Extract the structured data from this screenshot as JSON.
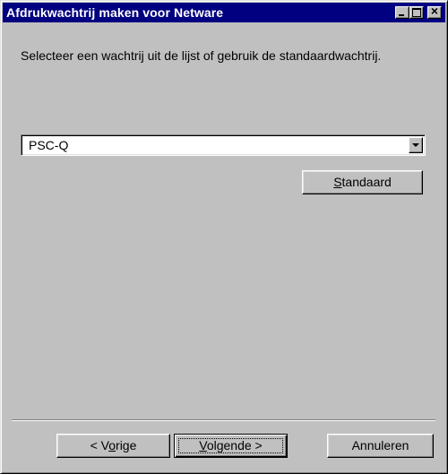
{
  "window": {
    "title": "Afdrukwachtrij maken voor Netware"
  },
  "title_buttons": {
    "minimize": "minimize-icon",
    "maximize": "maximize-icon",
    "close": "close-icon",
    "close_glyph": "×"
  },
  "content": {
    "prompt": "Selecteer een wachtrij uit de lijst of gebruik de standaardwachtrij.",
    "queue_select": {
      "value": "PSC-Q"
    },
    "default_button": {
      "label_before": "",
      "label_mnemonic": "S",
      "label_after": "tandaard"
    }
  },
  "footer": {
    "back": {
      "label_before": "< V",
      "label_mnemonic": "o",
      "label_after": "rige"
    },
    "next": {
      "label_before": "",
      "label_mnemonic": "V",
      "label_after": "olgende >"
    },
    "cancel": {
      "label": "Annuleren"
    }
  },
  "colors": {
    "titlebar": "#000080",
    "face": "#c0c0c0"
  }
}
